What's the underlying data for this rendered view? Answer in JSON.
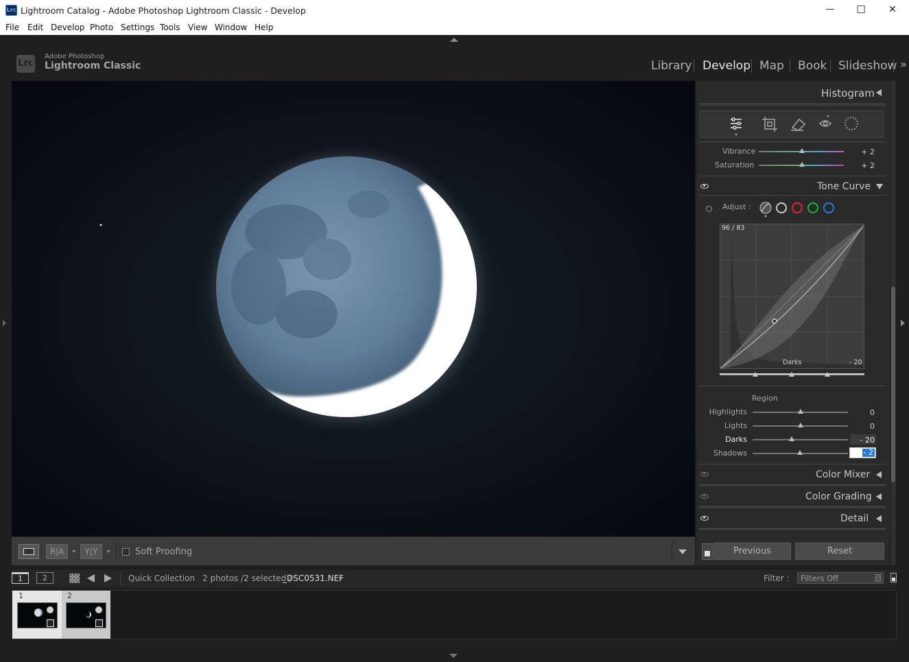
{
  "window": {
    "app_icon": "Lrc",
    "title": "Lightroom Catalog - Adobe Photoshop Lightroom Classic - Develop",
    "min_icon": "—",
    "max_icon": "☐",
    "close_icon": "✕"
  },
  "menu": [
    "File",
    "Edit",
    "Develop",
    "Photo",
    "Settings",
    "Tools",
    "View",
    "Window",
    "Help"
  ],
  "brand": {
    "logo": "Lrc",
    "line1": "Adobe Photoshop",
    "line2": "Lightroom Classic"
  },
  "modules": [
    "Library",
    "Develop",
    "Map",
    "Book",
    "Slideshow"
  ],
  "modules_more": "»",
  "panels": {
    "histogram": "Histogram",
    "basic": {
      "sliders": [
        {
          "label": "Vibrance",
          "value": "+ 2",
          "pos": 0.51
        },
        {
          "label": "Saturation",
          "value": "+ 2",
          "pos": 0.51
        }
      ]
    },
    "tone_curve": {
      "title": "Tone Curve",
      "adjust_label": "Adjust :",
      "readout": "96 / 83",
      "region_name": "Darks",
      "region_value": "- 20",
      "region_header": "Region",
      "sliders": [
        {
          "label": "Highlights",
          "value": "0",
          "pos": 0.5
        },
        {
          "label": "Lights",
          "value": "0",
          "pos": 0.5
        },
        {
          "label": "Darks",
          "value": "- 20",
          "pos": 0.4
        },
        {
          "label": "Shadows",
          "value": "- 2",
          "pos": 0.49
        }
      ]
    },
    "collapsed": [
      "Color Mixer",
      "Color Grading",
      "Detail"
    ]
  },
  "buttons": {
    "previous": "Previous",
    "reset": "Reset"
  },
  "toolbar": {
    "soft_proofing": "Soft Proofing",
    "ra": "R|A",
    "yy": "Y|Y"
  },
  "filmstrip": {
    "view1": "1",
    "view2": "2",
    "source": "Quick Collection",
    "count": "2 photos /2 selected /",
    "file": "_DSC0531.NEF",
    "filter_label": "Filter :",
    "filter_value": "Filters Off",
    "thumbs": [
      "1",
      "2"
    ]
  },
  "colors": {
    "accent": "#2a7ad5",
    "panel": "#2a2a2a",
    "bg": "#1f1f1f"
  },
  "icons": [
    "basic-icon",
    "crop-icon",
    "heal-icon",
    "redeye-icon",
    "mask-icon",
    "eye-icon",
    "target-icon"
  ]
}
